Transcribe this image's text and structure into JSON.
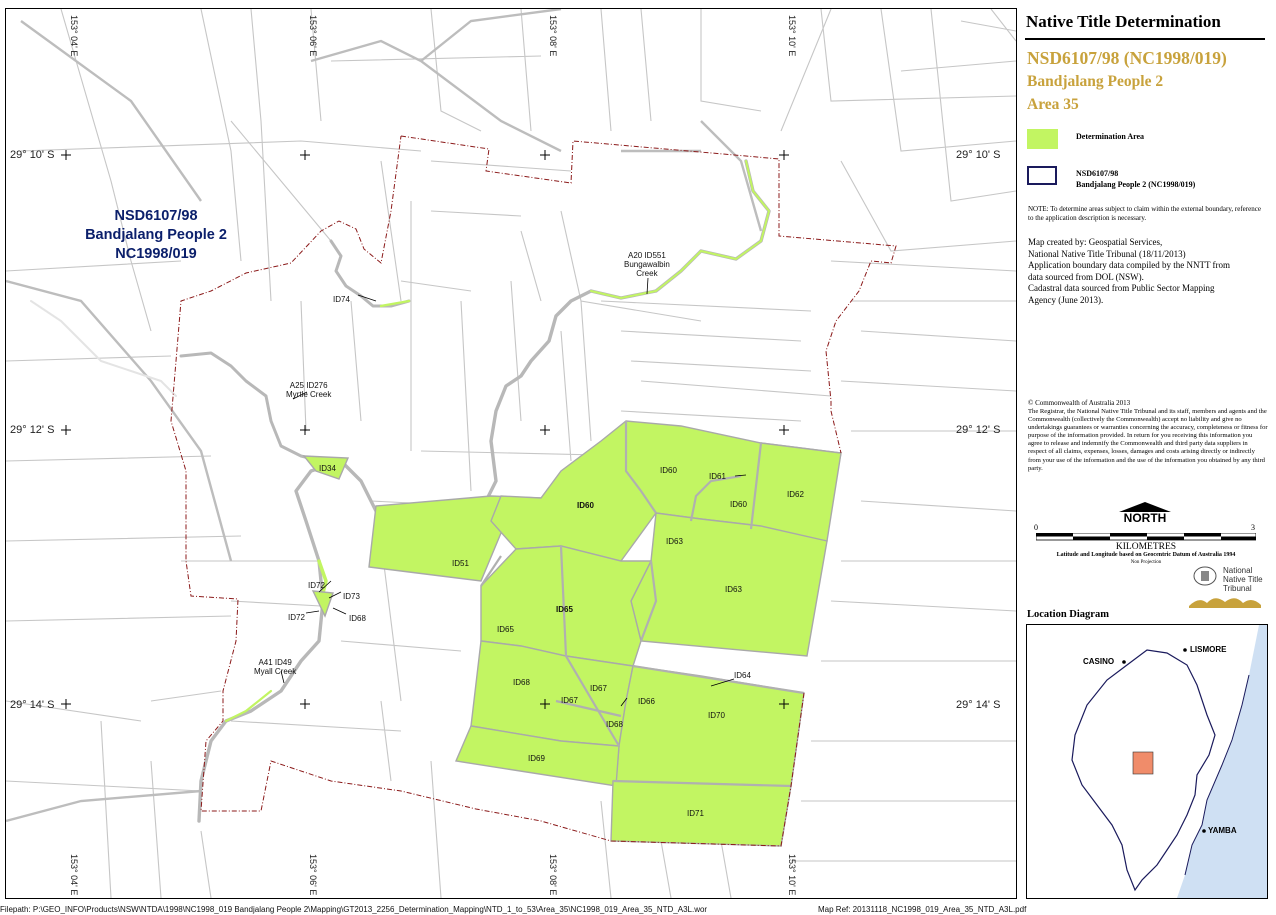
{
  "map": {
    "claim_title_lines": [
      "NSD6107/98",
      "Bandjalang People 2",
      "NC1998/019"
    ],
    "lat_labels": [
      "29° 10' S",
      "29° 12' S",
      "29° 14' S"
    ],
    "lon_labels": [
      "153° 04' E",
      "153° 06' E",
      "153° 08' E",
      "153° 10' E"
    ],
    "creek_labels": {
      "bungawalbin": [
        "A20 ID551",
        "Bungawalbin",
        "Creek"
      ],
      "myrtle": [
        "A25 ID276",
        "Myrtle Creek"
      ],
      "myall": [
        "A41 ID49",
        "Myall Creek"
      ]
    },
    "small_labels": {
      "id74": "ID74",
      "id72a": "ID72",
      "id73": "ID73",
      "id72b": "ID72",
      "id68a": "ID68"
    },
    "areas": {
      "id34": "ID34",
      "id51": "ID51",
      "id60a": "ID60",
      "id60b": "ID60",
      "id60c": "ID60",
      "id61": "ID61",
      "id62": "ID62",
      "id63a": "ID63",
      "id63b": "ID63",
      "id65a": "ID65",
      "id65b": "ID65",
      "id68b": "ID68",
      "id67a": "ID67",
      "id67b": "ID67",
      "id68c": "ID68",
      "id66": "ID66",
      "id64": "ID64",
      "id70": "ID70",
      "id69": "ID69",
      "id71": "ID71"
    },
    "colors": {
      "determination": "#c2f562",
      "boundary": "#8b1a1a",
      "road": "#c6c6c6",
      "creek": "#b5b5b5"
    }
  },
  "panel": {
    "title": "Native Title Determination",
    "case_number": "NSD6107/98 (NC1998/019)",
    "claim_name": "Bandjalang People 2",
    "area": "Area 35",
    "legend": {
      "determination": "Determination Area",
      "boundary_line1": "NSD6107/98",
      "boundary_line2": "Bandjalang People 2 (NC1998/019)"
    },
    "note": "NOTE: To determine areas subject to claim within the external boundary, reference to the application description is necessary.",
    "credits": [
      "Map created by: Geospatial Services,",
      "National Native Title Tribunal   (18/11/2013)",
      "Application boundary data compiled by the NNTT from",
      "data sourced from DOL (NSW).",
      "Cadastral data sourced from Public Sector Mapping",
      "Agency (June 2013)."
    ],
    "copyright": "© Commonwealth of Australia 2013",
    "disclaimer": "The Registrar, the National Native Title Tribunal and its staff, members and agents and the Commonwealth (collectively the Commonwealth) accept no liability and give no undertakings guarantees or warranties concerning the accuracy, completeness or fitness for purpose of the information provided. In return for you receiving this information you agree to release and indemnify the Commonwealth and third party data suppliers in respect of all claims, expenses, losses, damages and costs arising directly or indirectly from your use of the information and the use of the information you obtained by any third party.",
    "north": "NORTH",
    "scale": {
      "min": "0",
      "max": "3",
      "unit": "KILOMETRES"
    },
    "datum": "Latitude and Longitude based on Geocentric Datum of Australia 1994",
    "projection": "Non Projection",
    "tribunal_logo": [
      "National",
      "Native Title",
      "Tribunal"
    ],
    "location_title": "Location Diagram",
    "towns": {
      "casino": "CASINO",
      "lismore": "LISMORE",
      "yamba": "YAMBA"
    }
  },
  "footer": {
    "filepath": "Filepath: P:\\GEO_INFO\\Products\\NSW\\NTDA\\1998\\NC1998_019 Bandjalang People 2\\Mapping\\GT2013_2256_Determination_Mapping\\NTD_1_to_53\\Area_35\\NC1998_019_Area_35_NTD_A3L.wor",
    "map_ref": "Map Ref: 20131118_NC1998_019_Area_35_NTD_A3L.pdf"
  }
}
